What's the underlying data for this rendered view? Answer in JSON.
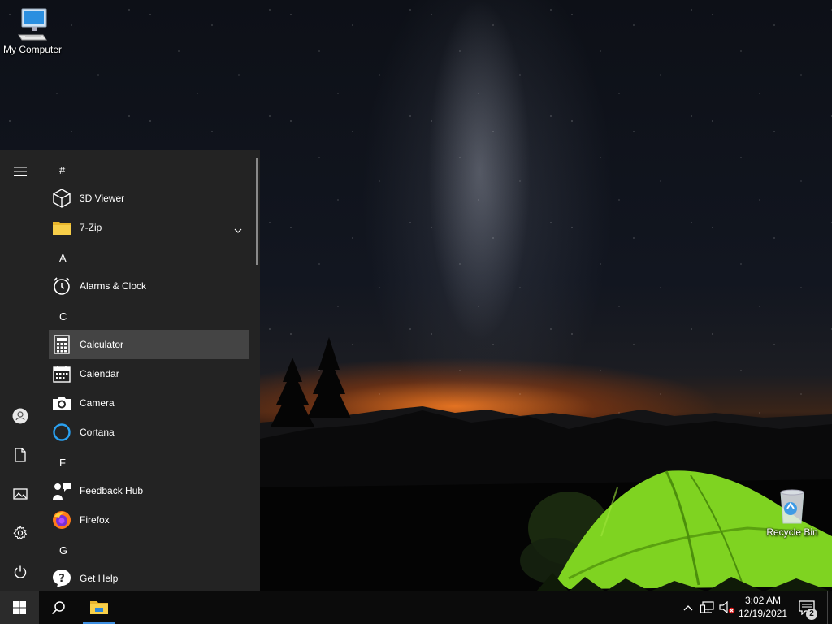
{
  "desktop": {
    "icons": [
      {
        "label": "My Computer",
        "icon": "computer-icon"
      },
      {
        "label": "Recycle Bin",
        "icon": "recycle-bin-icon"
      }
    ]
  },
  "start_menu": {
    "rail": [
      {
        "name": "expand-menu",
        "icon": "hamburger-icon"
      },
      {
        "name": "account",
        "icon": "user-icon"
      },
      {
        "name": "documents",
        "icon": "document-icon"
      },
      {
        "name": "pictures",
        "icon": "picture-icon"
      },
      {
        "name": "settings",
        "icon": "gear-icon"
      },
      {
        "name": "power",
        "icon": "power-icon"
      }
    ],
    "groups": [
      {
        "letter": "#",
        "apps": [
          {
            "name": "3D Viewer",
            "icon": "cube-icon"
          },
          {
            "name": "7-Zip",
            "icon": "folder-icon",
            "expandable": true
          }
        ]
      },
      {
        "letter": "A",
        "apps": [
          {
            "name": "Alarms & Clock",
            "icon": "alarm-clock-icon"
          }
        ]
      },
      {
        "letter": "C",
        "apps": [
          {
            "name": "Calculator",
            "icon": "calculator-icon",
            "highlighted": true
          },
          {
            "name": "Calendar",
            "icon": "calendar-icon"
          },
          {
            "name": "Camera",
            "icon": "camera-icon"
          },
          {
            "name": "Cortana",
            "icon": "cortana-ring-icon"
          }
        ]
      },
      {
        "letter": "F",
        "apps": [
          {
            "name": "Feedback Hub",
            "icon": "feedback-icon"
          },
          {
            "name": "Firefox",
            "icon": "firefox-icon"
          }
        ]
      },
      {
        "letter": "G",
        "apps": [
          {
            "name": "Get Help",
            "icon": "help-chat-icon"
          }
        ]
      }
    ]
  },
  "taskbar": {
    "start_icon": "windows-logo-icon",
    "search_icon": "search-icon",
    "pinned": [
      {
        "icon": "file-explorer-icon",
        "active": true
      }
    ],
    "tray": {
      "icons": [
        "chevron-up-icon",
        "network-icon",
        "volume-muted-icon"
      ],
      "time": "3:02 AM",
      "date": "12/19/2021",
      "notification_count": "2"
    }
  },
  "colors": {
    "start_bg": "#232323",
    "highlight": "#444444",
    "taskbar_bg": "#0b0b0b",
    "accent": "#3d8ee0"
  }
}
